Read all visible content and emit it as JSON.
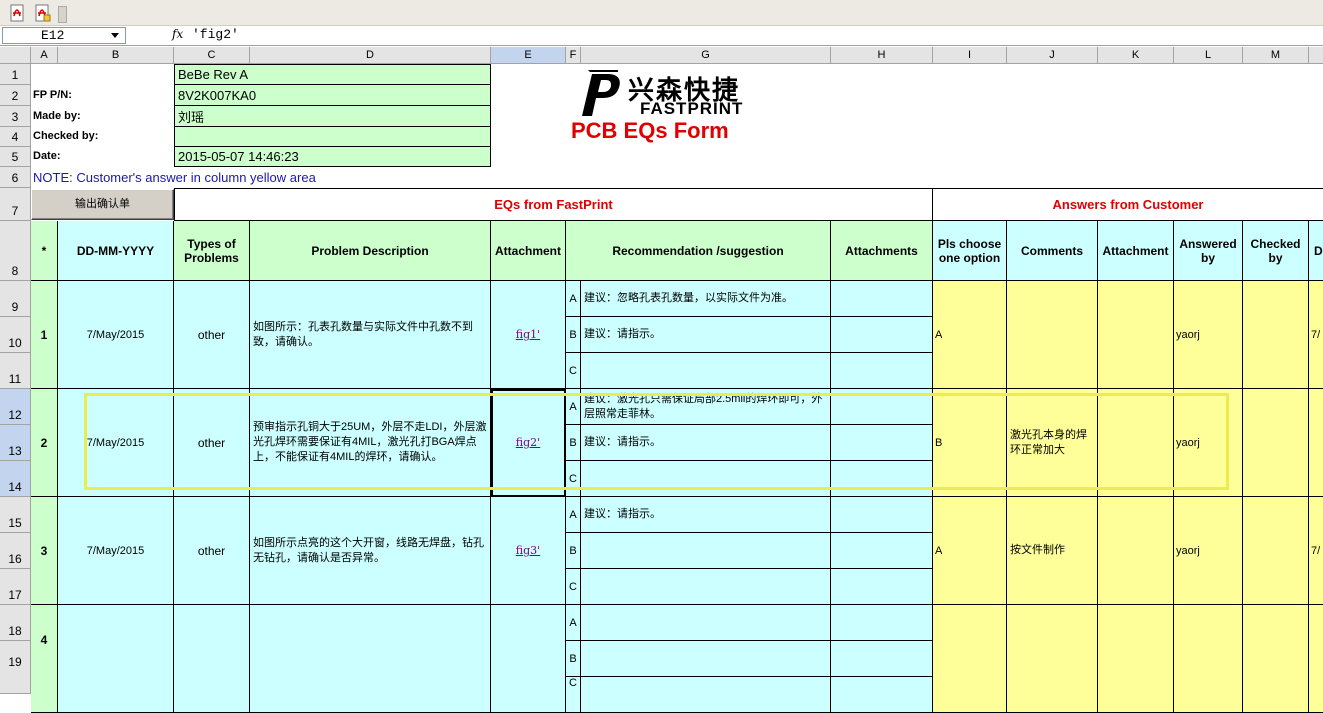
{
  "formula_bar": {
    "cell_ref": "E12",
    "fx": "fx",
    "content": "'fig2'"
  },
  "columns": [
    "A",
    "B",
    "C",
    "D",
    "E",
    "F",
    "G",
    "H",
    "I",
    "J",
    "K",
    "L",
    "M"
  ],
  "rows": [
    "1",
    "2",
    "3",
    "4",
    "5",
    "6",
    "7",
    "8",
    "9",
    "10",
    "11",
    "12",
    "13",
    "14",
    "15",
    "16",
    "17",
    "18",
    "19"
  ],
  "info": {
    "product": "BeBe Rev A",
    "fp_pn_label": "FP P/N:",
    "fp_pn": "8V2K007KA0",
    "made_by_label": "Made by:",
    "made_by": "刘瑶",
    "checked_by_label": "Checked by:",
    "checked_by": "",
    "date_label": "Date:",
    "date": "2015-05-07 14:46:23",
    "note": "NOTE: Customer's  answer in column yellow area"
  },
  "logo": {
    "cn": "兴森快捷",
    "en": "FASTPRINT",
    "form_title": "PCB EQs Form"
  },
  "export_button": "输出确认单",
  "section_headers": {
    "fastprint": "EQs from FastPrint",
    "customer": "Answers from Customer"
  },
  "table_headers": {
    "num": "*",
    "date": "DD-MM-YYYY",
    "types": "Types of Problems",
    "problem": "Problem Description",
    "attachment": "Attachment",
    "recommendation": "Recommendation /suggestion",
    "attachments": "Attachments",
    "choose": "Pls choose one option",
    "comments": "Comments",
    "cust_attachment": "Attachment",
    "answered_by": "Answered by",
    "checked_by": "Checked by",
    "last": "D"
  },
  "eqs": [
    {
      "num": "1",
      "date": "7/May/2015",
      "type": "other",
      "problem": "如图所示：孔表孔数量与实际文件中孔数不到致，请确认。",
      "attachment": "fig1'",
      "options": [
        {
          "letter": "A",
          "text": "建议：忽略孔表孔数量，以实际文件为准。"
        },
        {
          "letter": "B",
          "text": "建议：请指示。"
        },
        {
          "letter": "C",
          "text": ""
        }
      ],
      "choice": "A",
      "comments": "",
      "answered_by": "yaorj",
      "last": "7/"
    },
    {
      "num": "2",
      "date": "7/May/2015",
      "type": "other",
      "problem": "预审指示孔铜大于25UM，外层不走LDI，外层激光孔焊环需要保证有4MIL，激光孔打BGA焊点上，不能保证有4MIL的焊环，请确认。",
      "attachment": "fig2'",
      "options": [
        {
          "letter": "A",
          "text": "建议：激光孔只需保证局部2.5mil的焊环即可，外层照常走菲林。"
        },
        {
          "letter": "B",
          "text": "建议：请指示。"
        },
        {
          "letter": "C",
          "text": ""
        }
      ],
      "choice": "B",
      "comments": "激光孔本身的焊环正常加大",
      "answered_by": "yaorj",
      "last": ""
    },
    {
      "num": "3",
      "date": "7/May/2015",
      "type": "other",
      "problem": "如图所示点亮的这个大开窗，线路无焊盘，钻孔无钻孔，请确认是否异常。",
      "attachment": "fig3'",
      "options": [
        {
          "letter": "A",
          "text": "建议：请指示。"
        },
        {
          "letter": "B",
          "text": ""
        },
        {
          "letter": "C",
          "text": ""
        }
      ],
      "choice": "A",
      "comments": "按文件制作",
      "answered_by": "yaorj",
      "last": "7/"
    },
    {
      "num": "4",
      "date": "",
      "type": "",
      "problem": "",
      "attachment": "",
      "options": [
        {
          "letter": "A",
          "text": ""
        },
        {
          "letter": "B",
          "text": ""
        },
        {
          "letter": "C",
          "text": ""
        }
      ],
      "choice": "",
      "comments": "",
      "answered_by": "",
      "last": ""
    }
  ]
}
